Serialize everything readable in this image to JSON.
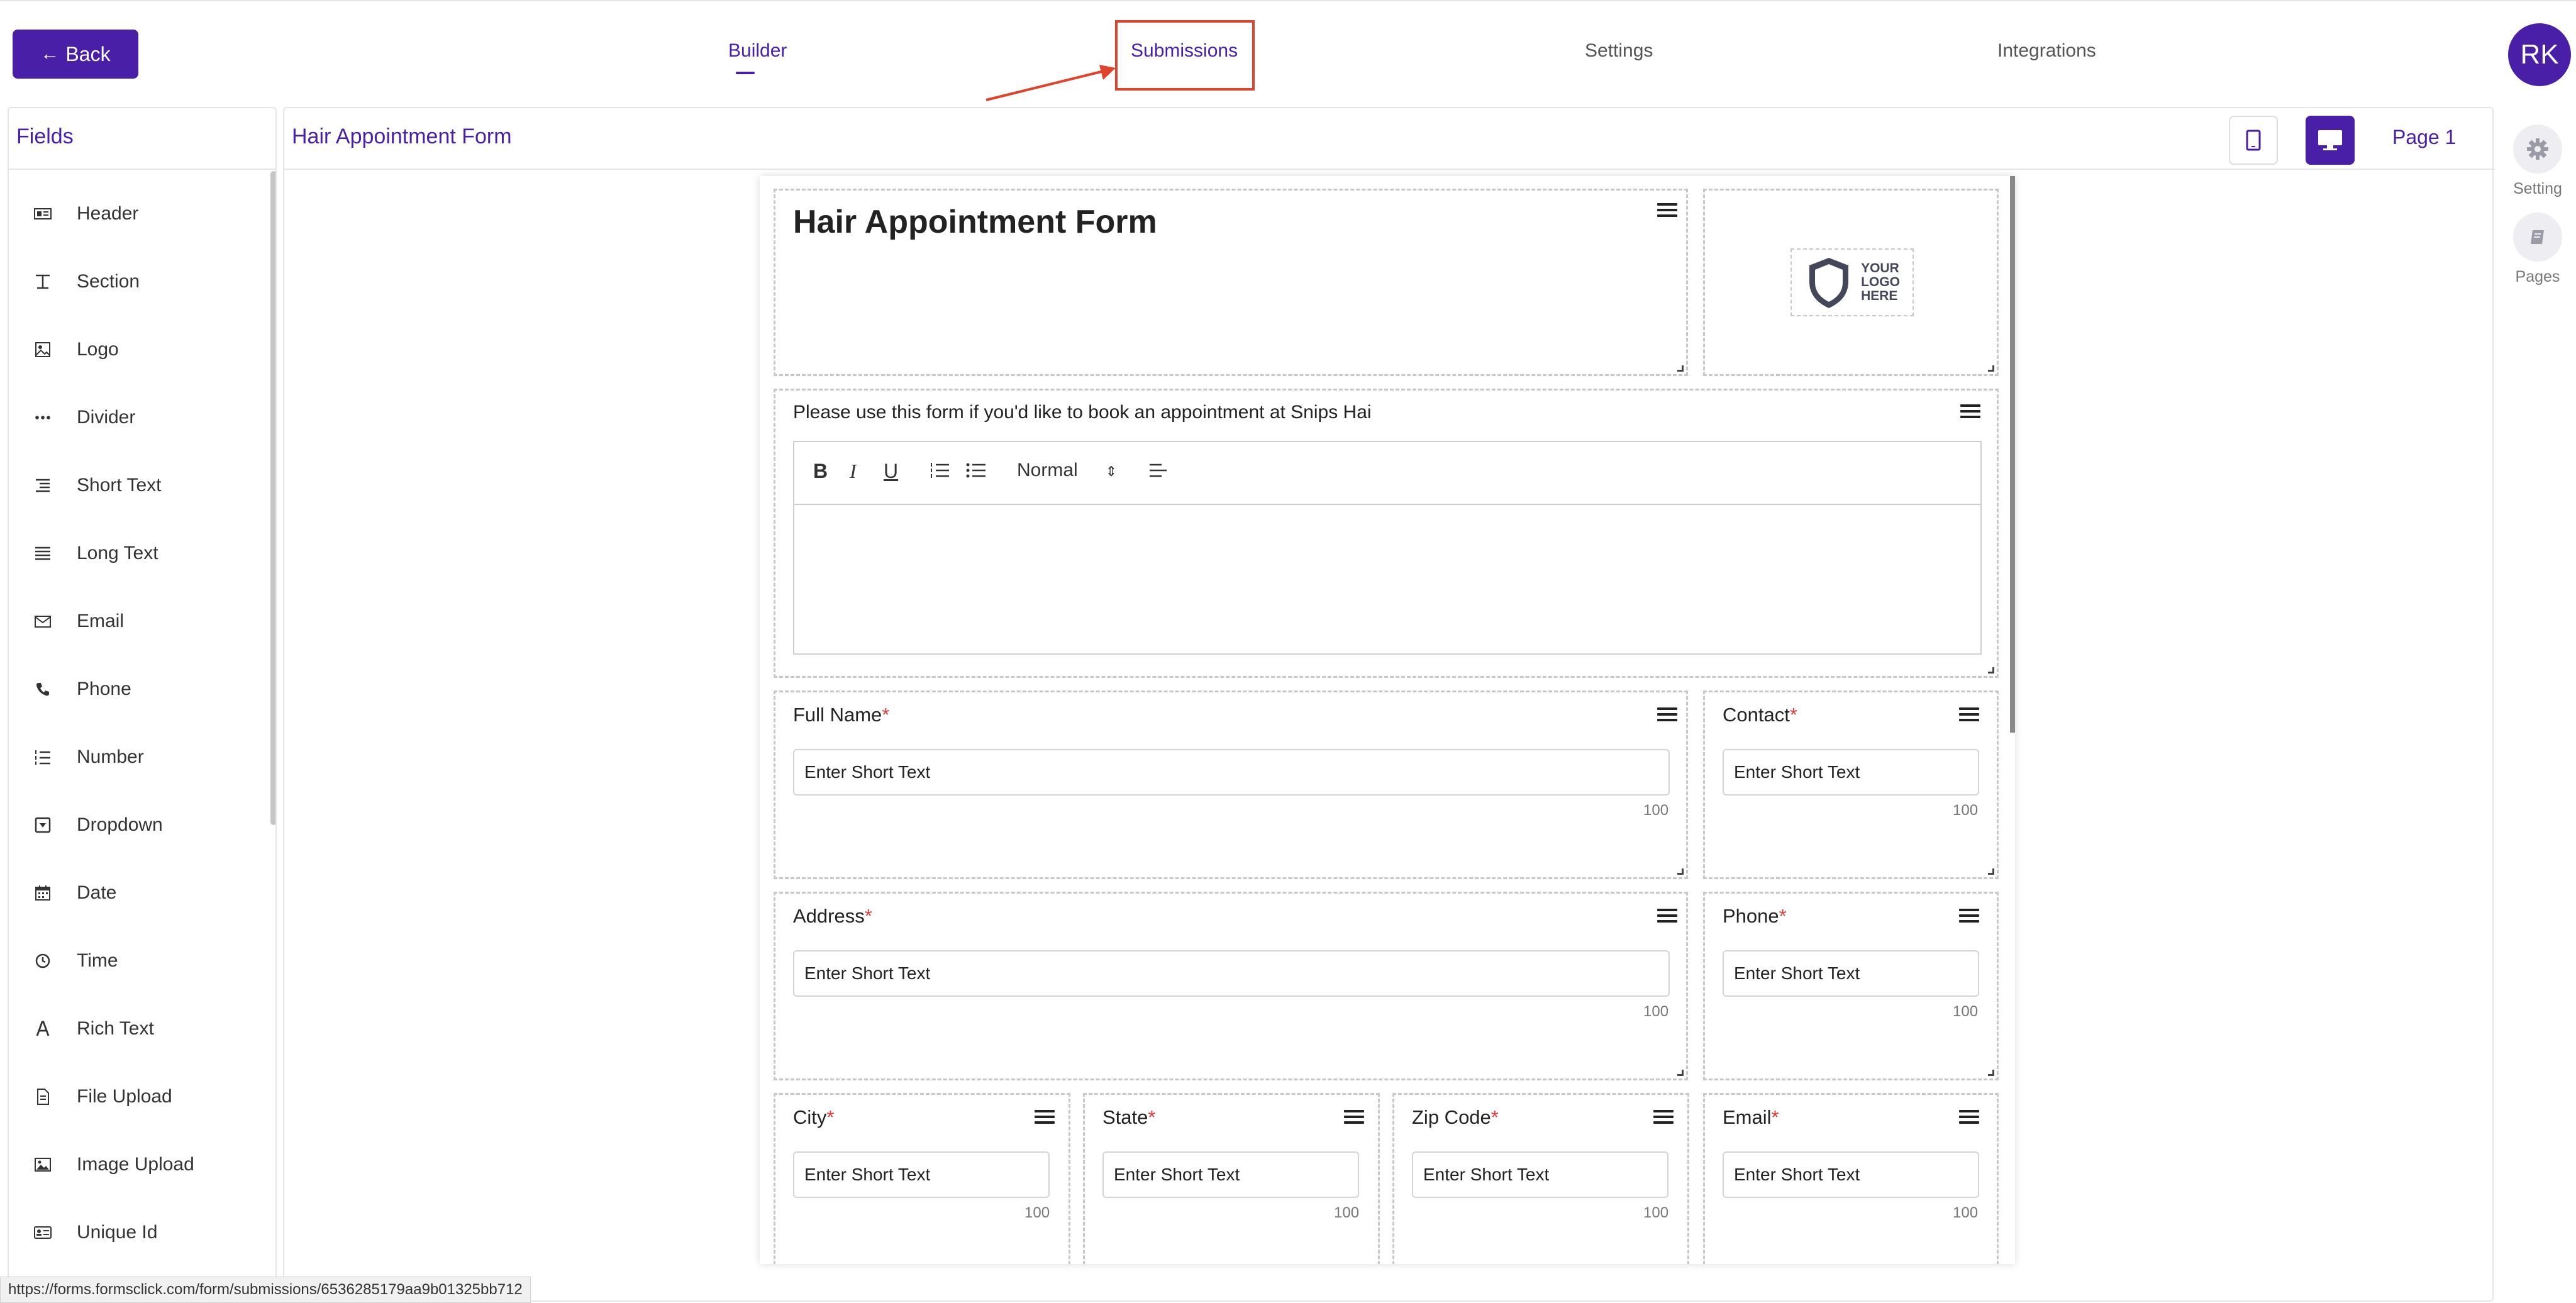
{
  "topbar": {
    "back_label": "Back",
    "tabs": [
      "Builder",
      "Submissions",
      "Settings",
      "Integrations"
    ],
    "active_tab": "Builder",
    "highlighted_tab": "Submissions",
    "annotation_color": "#e0432a",
    "avatar_initials": "RK"
  },
  "fields_panel": {
    "title": "Fields",
    "items": [
      {
        "label": "Header",
        "icon": "header-icon"
      },
      {
        "label": "Section",
        "icon": "text-type-icon"
      },
      {
        "label": "Logo",
        "icon": "image-icon"
      },
      {
        "label": "Divider",
        "icon": "divider-dots-icon"
      },
      {
        "label": "Short Text",
        "icon": "short-text-icon"
      },
      {
        "label": "Long Text",
        "icon": "long-text-icon"
      },
      {
        "label": "Email",
        "icon": "envelope-icon"
      },
      {
        "label": "Phone",
        "icon": "phone-icon"
      },
      {
        "label": "Number",
        "icon": "numbered-list-icon"
      },
      {
        "label": "Dropdown",
        "icon": "dropdown-icon"
      },
      {
        "label": "Date",
        "icon": "calendar-icon"
      },
      {
        "label": "Time",
        "icon": "clock-icon"
      },
      {
        "label": "Rich Text",
        "icon": "rich-text-icon"
      },
      {
        "label": "File Upload",
        "icon": "file-icon"
      },
      {
        "label": "Image Upload",
        "icon": "image-upload-icon"
      },
      {
        "label": "Unique Id",
        "icon": "id-card-icon"
      }
    ]
  },
  "main": {
    "title": "Hair Appointment Form",
    "page_label": "Page 1"
  },
  "right_rail": {
    "setting_label": "Setting",
    "pages_label": "Pages"
  },
  "form": {
    "title": "Hair Appointment Form",
    "logo_text": [
      "YOUR",
      "LOGO",
      "HERE"
    ],
    "intro": "Please use this form if you'd like to book an appointment at Snips Hai",
    "rte_style": "Normal",
    "fields": {
      "full_name": {
        "label": "Full Name",
        "placeholder": "Enter Short Text",
        "max": "100"
      },
      "contact": {
        "label": "Contact",
        "placeholder": "Enter Short Text",
        "max": "100"
      },
      "address": {
        "label": "Address",
        "placeholder": "Enter Short Text",
        "max": "100"
      },
      "phone": {
        "label": "Phone",
        "placeholder": "Enter Short Text",
        "max": "100"
      },
      "city": {
        "label": "City",
        "placeholder": "Enter Short Text",
        "max": "100"
      },
      "state": {
        "label": "State",
        "placeholder": "Enter Short Text",
        "max": "100"
      },
      "zip": {
        "label": "Zip Code",
        "placeholder": "Enter Short Text",
        "max": "100"
      },
      "email": {
        "label": "Email",
        "placeholder": "Enter Short Text",
        "max": "100"
      }
    },
    "required_mark": "*"
  },
  "status_url": "https://forms.formsclick.com/form/submissions/6536285179aa9b01325bb712",
  "colors": {
    "accent": "#4a1fa8",
    "required": "#e23b3b"
  }
}
